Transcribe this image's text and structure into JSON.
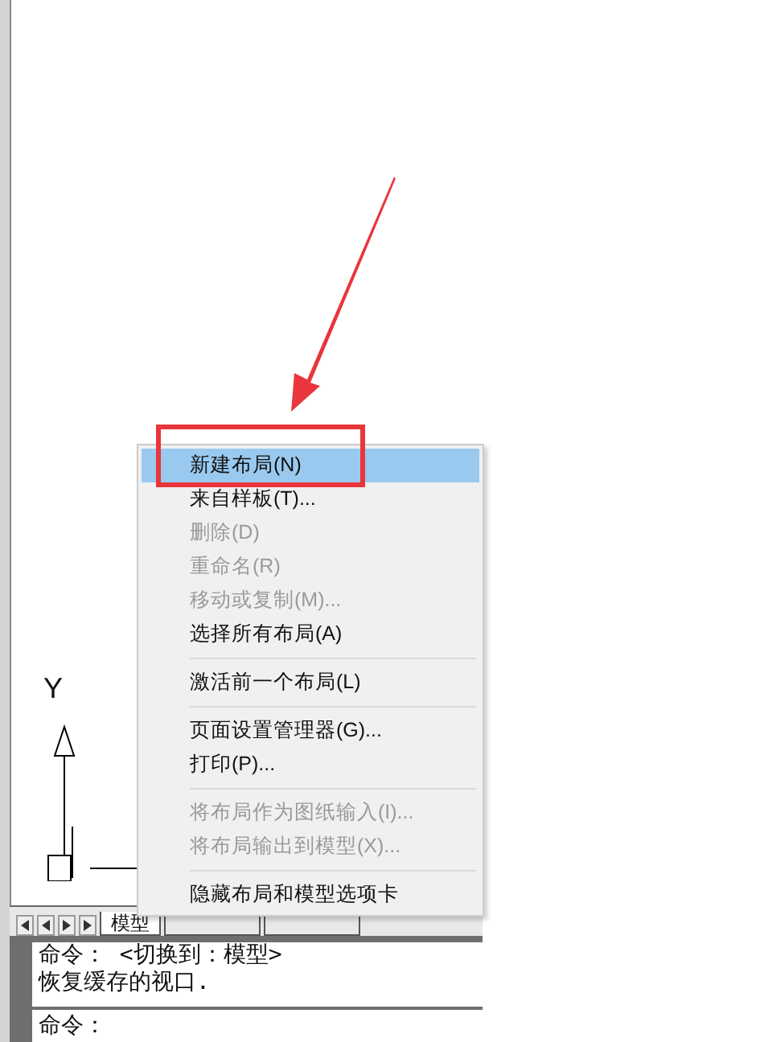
{
  "ucs_icon": {
    "axis_label": "Y"
  },
  "layout_tabs": [
    {
      "label": "模型",
      "selected": true
    },
    {
      "selected": false
    },
    {
      "selected": false
    }
  ],
  "context_menu": {
    "items": [
      {
        "kind": "item",
        "label": "新建布局(N)",
        "selected": true,
        "disabled": false
      },
      {
        "kind": "item",
        "label": "来自样板(T)...",
        "selected": false,
        "disabled": false
      },
      {
        "kind": "item",
        "label": "删除(D)",
        "selected": false,
        "disabled": true
      },
      {
        "kind": "item",
        "label": "重命名(R)",
        "selected": false,
        "disabled": true
      },
      {
        "kind": "item",
        "label": "移动或复制(M)...",
        "selected": false,
        "disabled": true
      },
      {
        "kind": "item",
        "label": "选择所有布局(A)",
        "selected": false,
        "disabled": false
      },
      {
        "kind": "separator"
      },
      {
        "kind": "item",
        "label": "激活前一个布局(L)",
        "selected": false,
        "disabled": false
      },
      {
        "kind": "separator"
      },
      {
        "kind": "item",
        "label": "页面设置管理器(G)...",
        "selected": false,
        "disabled": false
      },
      {
        "kind": "item",
        "label": "打印(P)...",
        "selected": false,
        "disabled": false
      },
      {
        "kind": "separator"
      },
      {
        "kind": "item",
        "label": "将布局作为图纸输入(I)...",
        "selected": false,
        "disabled": true
      },
      {
        "kind": "item",
        "label": "将布局输出到模型(X)...",
        "selected": false,
        "disabled": true
      },
      {
        "kind": "separator"
      },
      {
        "kind": "item",
        "label": "隐藏布局和模型选项卡",
        "selected": false,
        "disabled": false
      }
    ]
  },
  "command_window": {
    "history": [
      "命令：  <切换到：模型>",
      "恢复缓存的视口."
    ],
    "prompt": "命令："
  }
}
